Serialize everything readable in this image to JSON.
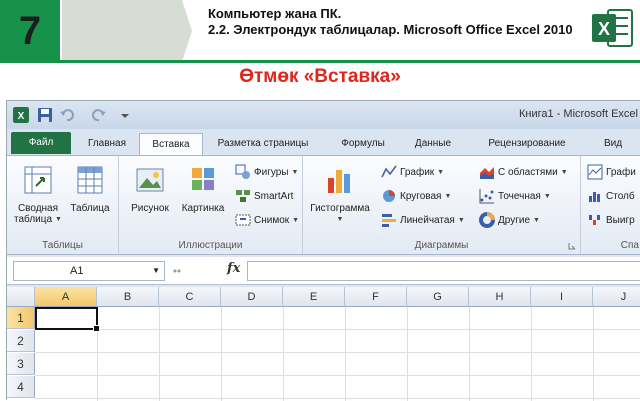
{
  "slide": {
    "grade": "7",
    "title_line1": "Компьютер жана ПК.",
    "title_line2": "2.2. Электрондук таблицалар. Microsoft Office Excel 2010",
    "heading": "Өтмөк «Вставка»",
    "logo_letter": "X"
  },
  "window": {
    "title": "Книга1 - Microsoft Excel"
  },
  "tabs": [
    {
      "label": "Файл"
    },
    {
      "label": "Главная"
    },
    {
      "label": "Вставка"
    },
    {
      "label": "Разметка страницы"
    },
    {
      "label": "Формулы"
    },
    {
      "label": "Данные"
    },
    {
      "label": "Рецензирование"
    },
    {
      "label": "Вид"
    }
  ],
  "ribbon": {
    "groups": [
      {
        "label": "Таблицы"
      },
      {
        "label": "Иллюстрации"
      },
      {
        "label": "Диаграммы"
      },
      {
        "label": "Спа"
      }
    ],
    "pivot_line1": "Сводная",
    "pivot_line2": "таблица",
    "table": "Таблица",
    "picture": "Рисунок",
    "clipart": "Картинка",
    "shapes": "Фигуры",
    "smartart": "SmartArt",
    "screenshot": "Снимок",
    "histogram": "Гистограмма",
    "graph": "График",
    "pie": "Круговая",
    "bar": "Линейчатая",
    "area": "С областями",
    "scatter": "Точечная",
    "other": "Другие",
    "spark_graph": "Графи",
    "spark_column": "Столб",
    "spark_winloss": "Выигр"
  },
  "formula_bar": {
    "name_box": "A1",
    "fx": "fx"
  },
  "columns": [
    "A",
    "B",
    "C",
    "D",
    "E",
    "F",
    "G",
    "H",
    "I",
    "J"
  ],
  "rows": [
    "1",
    "2",
    "3",
    "4"
  ],
  "colors": {
    "excel_green": "#217346",
    "slide_green": "#17924a",
    "heading_red": "#e0261b",
    "selected_header": "#f3c76b"
  }
}
